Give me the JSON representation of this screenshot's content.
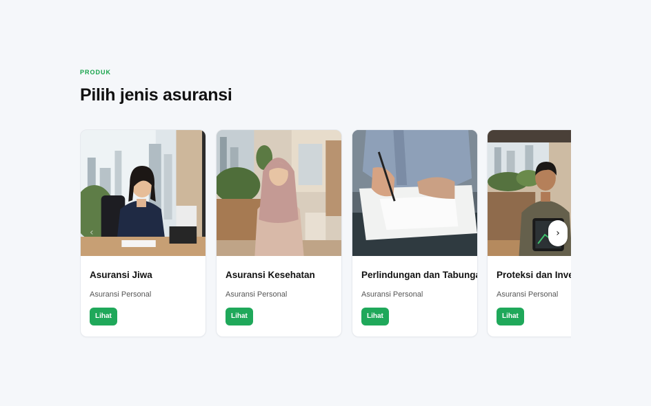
{
  "section": {
    "eyebrow": "PRODUK",
    "heading": "Pilih jenis asuransi"
  },
  "cards": [
    {
      "title": "Asuransi Jiwa",
      "subtitle": "Asuransi Personal",
      "cta": "Lihat",
      "image": "woman-in-office-photo"
    },
    {
      "title": "Asuransi Kesehatan",
      "subtitle": "Asuransi Personal",
      "cta": "Lihat",
      "image": "woman-in-hijab-photo"
    },
    {
      "title": "Perlindungan dan Tabungan",
      "subtitle": "Asuransi Personal",
      "cta": "Lihat",
      "image": "signing-document-photo"
    },
    {
      "title": "Proteksi dan Investasi",
      "subtitle": "Asuransi Personal",
      "cta": "Lihat",
      "image": "man-with-tablet-photo"
    }
  ],
  "carousel": {
    "next_icon": "chevron-right-icon",
    "next_glyph": "›",
    "prev_icon": "chevron-left-icon",
    "prev_glyph": "‹"
  },
  "colors": {
    "accent": "#1fa85a",
    "eyebrow": "#16a34a",
    "background": "#f5f7fa"
  }
}
